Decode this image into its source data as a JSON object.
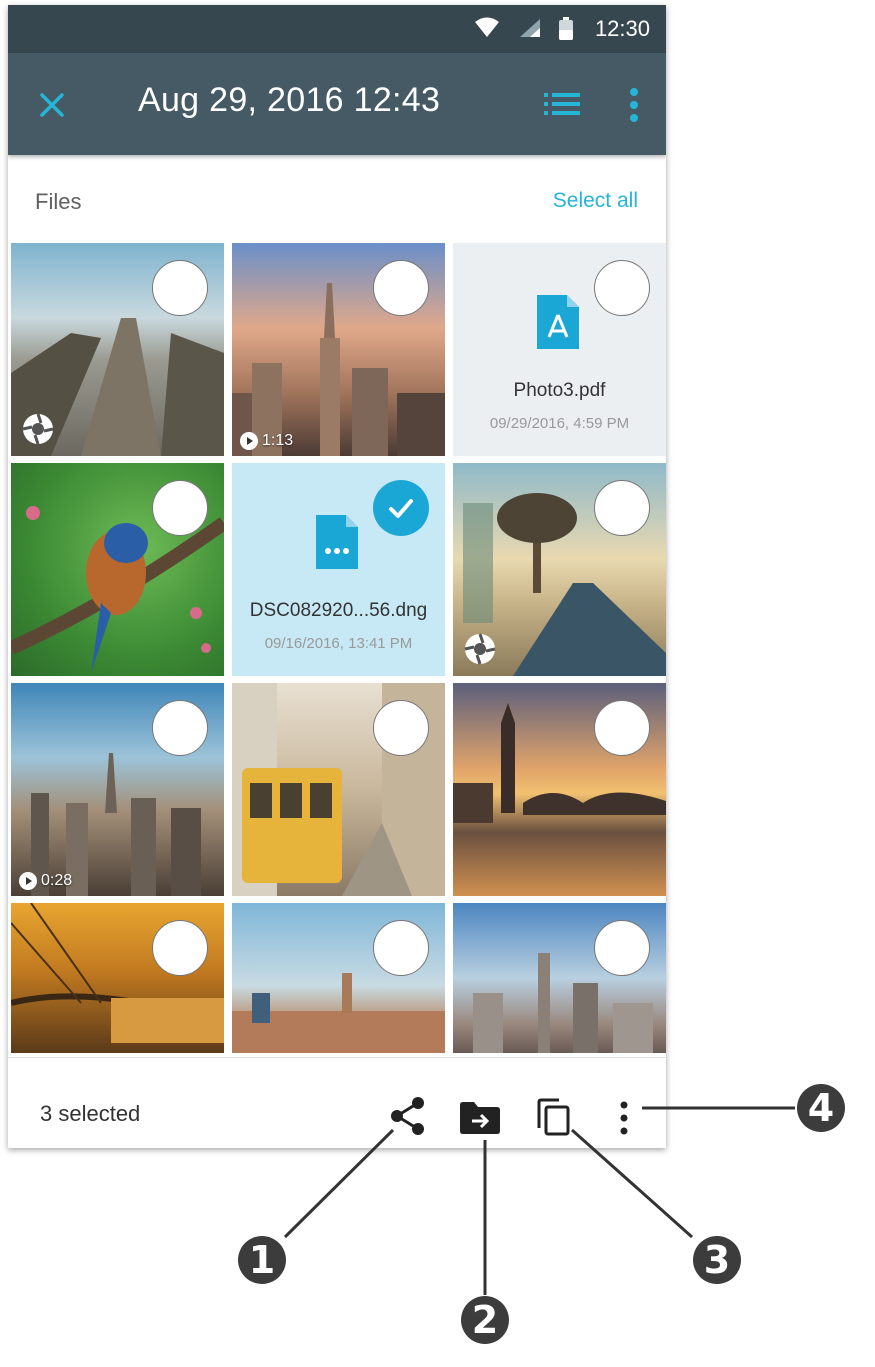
{
  "status_bar": {
    "time": "12:30",
    "icons": [
      "wifi-icon",
      "signal-icon",
      "battery-icon"
    ]
  },
  "app_bar": {
    "title": "Aug 29, 2016 12:43",
    "icons": [
      "close-icon",
      "list-view-icon",
      "more-vert-icon"
    ]
  },
  "files_header": {
    "label": "Files",
    "select_all": "Select all"
  },
  "tiles": [
    {
      "kind": "photo",
      "scene": "boardwalk",
      "selected": false,
      "badge": "burst-icon"
    },
    {
      "kind": "photo",
      "scene": "new-york",
      "selected": false,
      "badge": "video-icon",
      "duration": "1:13"
    },
    {
      "kind": "file",
      "file_icon": "pdf-icon",
      "name": "Photo3.pdf",
      "date": "09/29/2016, 4:59 PM",
      "selected": false
    },
    {
      "kind": "photo",
      "scene": "bird",
      "selected": false
    },
    {
      "kind": "file",
      "file_icon": "document-icon",
      "name": "DSC082920...56.dng",
      "date": "09/16/2016, 13:41 PM",
      "selected": true
    },
    {
      "kind": "photo",
      "scene": "desert-road",
      "selected": false,
      "badge": "burst-icon"
    },
    {
      "kind": "photo",
      "scene": "dubai",
      "selected": false,
      "badge": "video-icon",
      "duration": "0:28"
    },
    {
      "kind": "photo",
      "scene": "tram",
      "selected": false
    },
    {
      "kind": "photo",
      "scene": "london",
      "selected": false
    },
    {
      "kind": "photo",
      "scene": "bridge",
      "selected": false
    },
    {
      "kind": "photo",
      "scene": "plaza",
      "selected": false
    },
    {
      "kind": "photo",
      "scene": "skyline",
      "selected": false
    }
  ],
  "bottom_bar": {
    "selected_count": "3 selected",
    "actions": [
      "share-icon",
      "move-to-folder-icon",
      "copy-icon",
      "more-vert-icon"
    ]
  },
  "callouts": [
    "1",
    "2",
    "3",
    "4"
  ],
  "colors": {
    "status_bar": "#37474f",
    "app_bar": "#455a64",
    "accent": "#26b5d6",
    "selected_bg": "#c7e9f6"
  }
}
